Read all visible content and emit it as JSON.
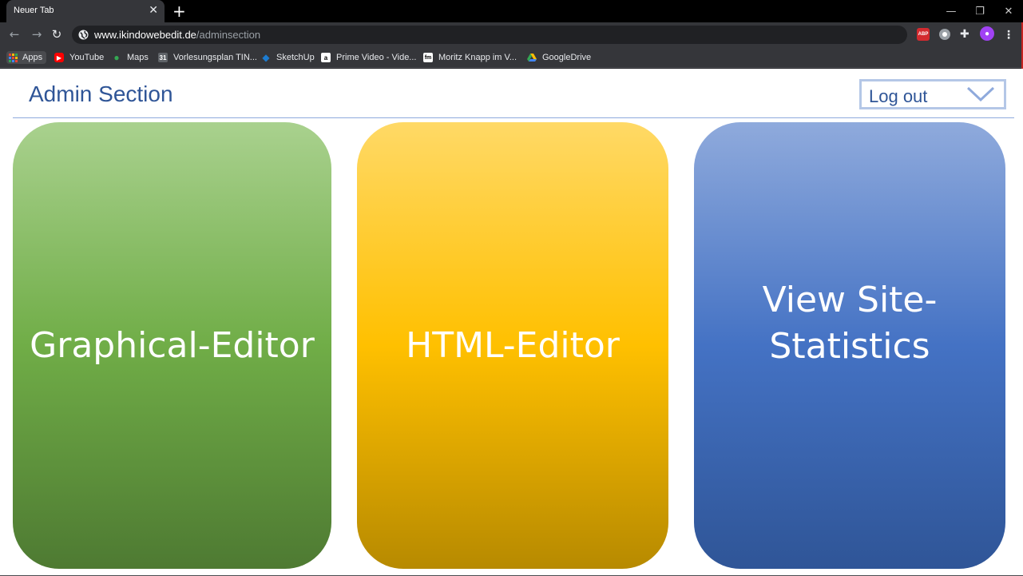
{
  "browser": {
    "tab_title": "Neuer Tab",
    "new_tab_symbol": "+",
    "url_host": "www.ikindowebedit.de",
    "url_path": "/adminsection",
    "window_controls": [
      "—",
      "❐",
      "✕"
    ],
    "bookmarks": [
      {
        "label": "Apps",
        "icon": "apps-grid-icon"
      },
      {
        "label": "YouTube",
        "icon": "youtube-icon",
        "color": "#ff0000"
      },
      {
        "label": "Maps",
        "icon": "maps-pin-icon",
        "color": "#34a853"
      },
      {
        "label": "Vorlesungsplan TIN...",
        "icon": "calendar-icon",
        "color": "#5f6368"
      },
      {
        "label": "SketchUp",
        "icon": "sketchup-icon",
        "color": "#1c7bd0"
      },
      {
        "label": "Prime Video - Vide...",
        "icon": "amazon-icon",
        "color": "#ffffff"
      },
      {
        "label": "Moritz Knapp im V...",
        "icon": "fm-icon",
        "color": "#ffffff"
      },
      {
        "label": "GoogleDrive",
        "icon": "google-drive-icon",
        "color": "#fbbc04"
      }
    ],
    "extensions": {
      "abp": "ABP"
    }
  },
  "page": {
    "title": "Admin Section",
    "logout_label": "Log out",
    "cards": [
      {
        "label": "Graphical-Editor",
        "color_top": "#a9d18e",
        "color_bottom": "#4e7a32"
      },
      {
        "label": "HTML-Editor",
        "color_top": "#ffd966",
        "color_bottom": "#b78a00"
      },
      {
        "label": "View Site-\nStatistics",
        "color_top": "#8faadc",
        "color_bottom": "#2f5597"
      }
    ],
    "accent_color": "#2f5597"
  }
}
